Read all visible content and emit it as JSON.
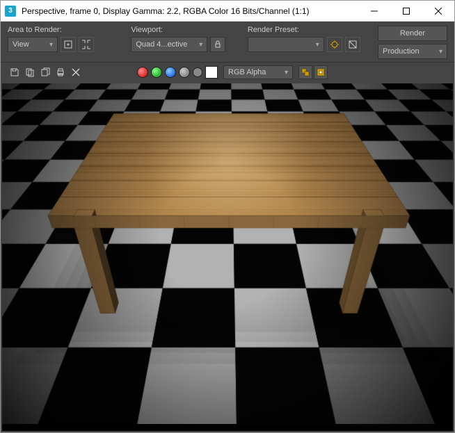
{
  "title": "Perspective, frame 0, Display Gamma: 2.2, RGBA Color 16 Bits/Channel (1:1)",
  "panel": {
    "area_label": "Area to Render:",
    "area_value": "View",
    "viewport_label": "Viewport:",
    "viewport_value": "Quad 4...ective",
    "preset_label": "Render Preset:",
    "preset_value": "",
    "render_btn": "Render",
    "production_value": "Production"
  },
  "toolbar": {
    "alpha_value": "RGB Alpha"
  }
}
